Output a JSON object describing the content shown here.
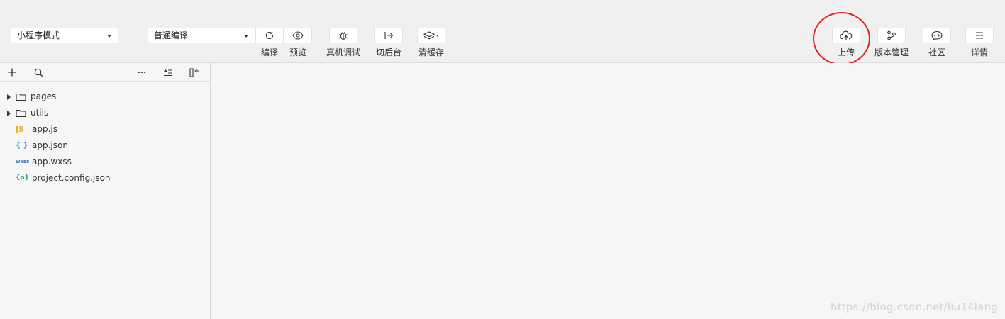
{
  "toolbar": {
    "mode_select": "小程序模式",
    "compile_select": "普通编译",
    "buttons": {
      "compile": "编译",
      "preview": "预览",
      "remote_debug": "真机调试",
      "background": "切后台",
      "clear_cache": "清缓存",
      "upload": "上传",
      "version": "版本管理",
      "community": "社区",
      "details": "详情"
    }
  },
  "sidebar": {
    "toolbar_icons": [
      "add-icon",
      "search-icon",
      "more-icon",
      "sort-icon",
      "collapse-panel-icon"
    ],
    "tree": [
      {
        "type": "folder",
        "name": "pages"
      },
      {
        "type": "folder",
        "name": "utils"
      },
      {
        "type": "file",
        "badge": "JS",
        "name": "app.js",
        "color": "#e6b422"
      },
      {
        "type": "file",
        "badge": "{ }",
        "name": "app.json",
        "color": "#2f9bd6"
      },
      {
        "type": "file",
        "badge": "wxss",
        "name": "app.wxss",
        "color": "#2a6fb8"
      },
      {
        "type": "file",
        "badge": "{o}",
        "name": "project.config.json",
        "color": "#1aa36b"
      }
    ]
  },
  "watermark": "https://blog.csdn.net/liu14lang",
  "colors": {
    "highlight": "#e02020",
    "toolbar_bg": "#f0f0f0",
    "panel_bg": "#f5f6f5"
  }
}
